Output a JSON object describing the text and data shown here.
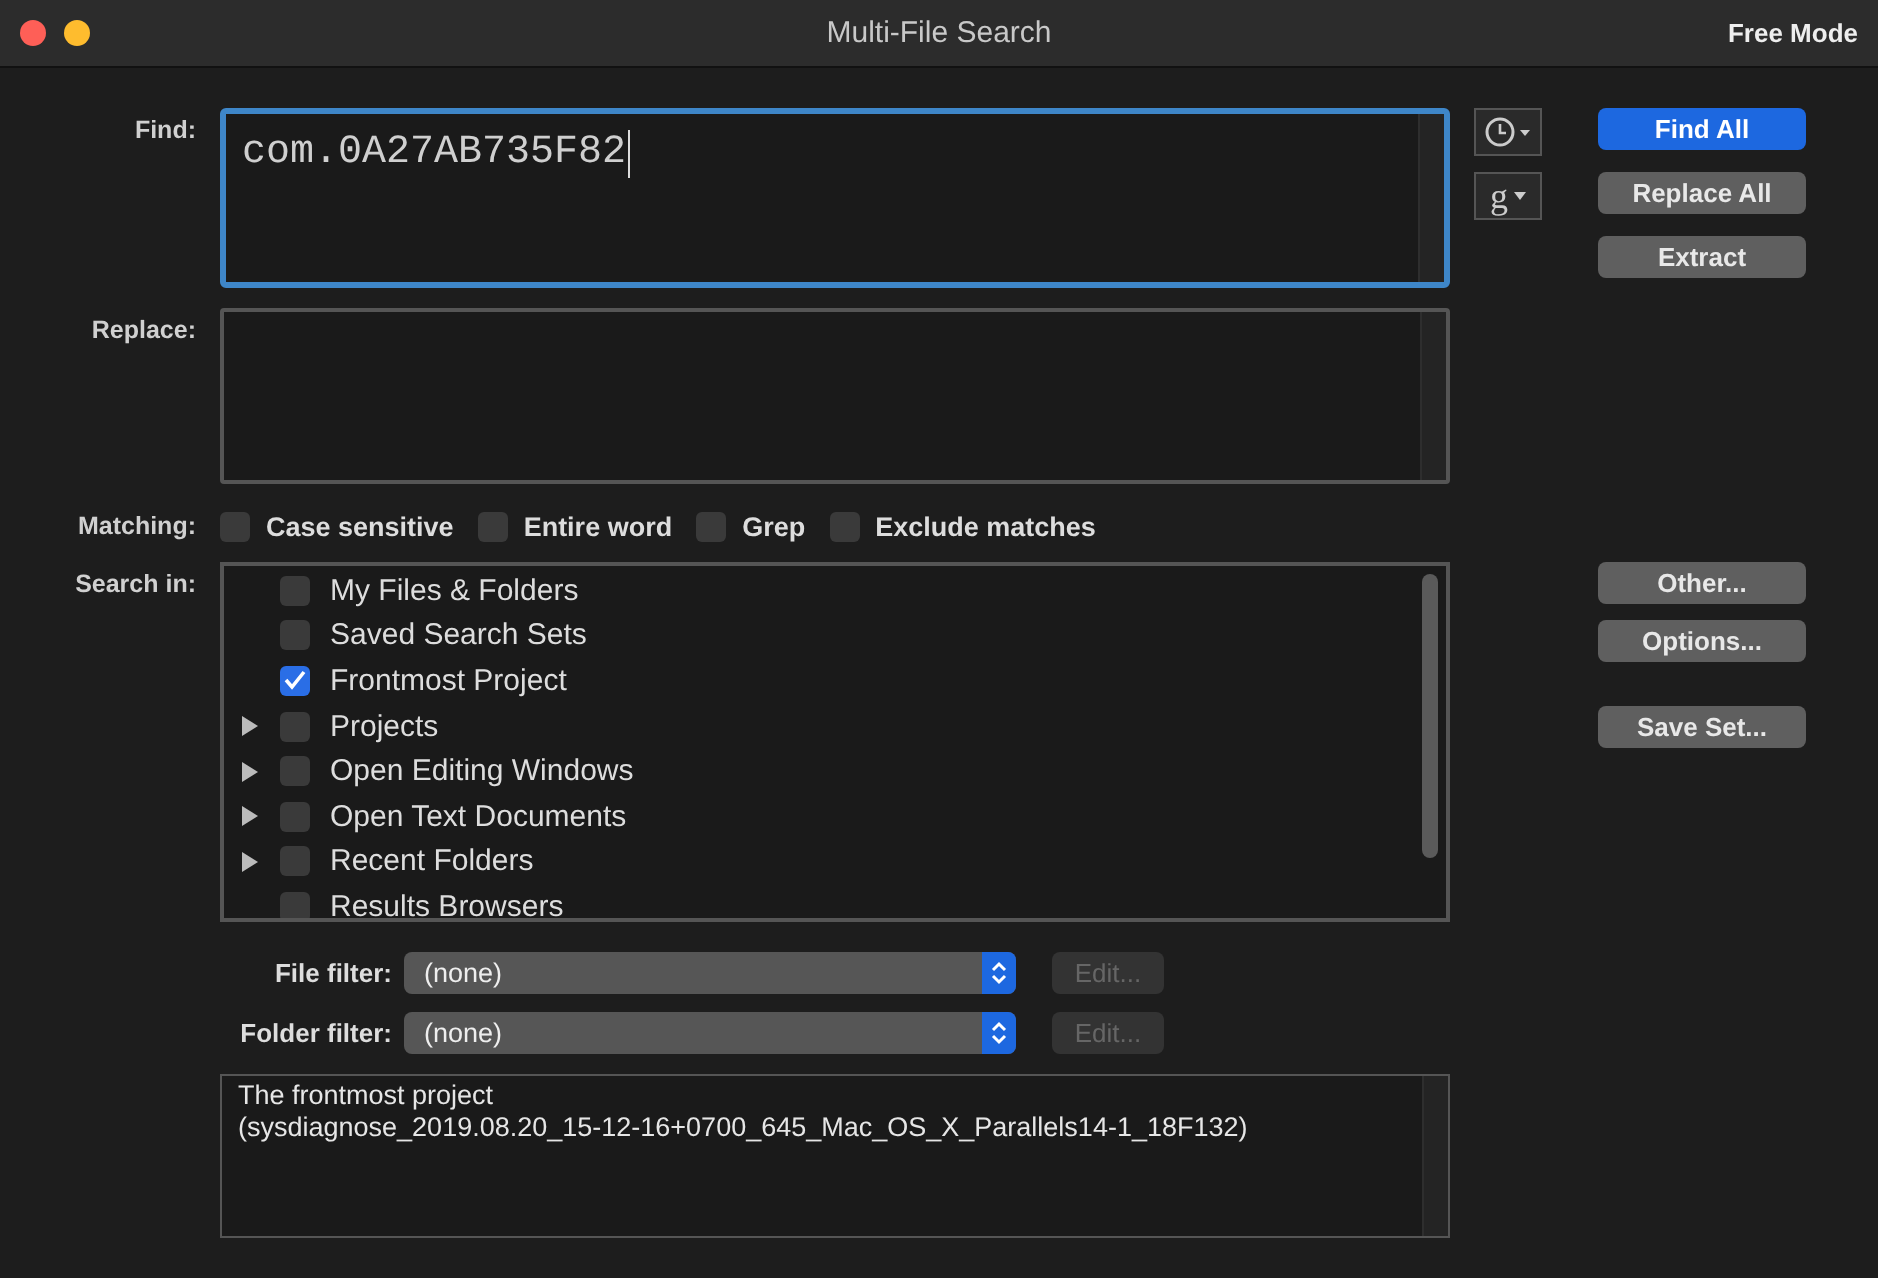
{
  "window": {
    "title": "Multi-File Search",
    "mode_label": "Free Mode"
  },
  "find": {
    "label": "Find:",
    "value": "com.0A27AB735F82",
    "grep_menu_label": "g"
  },
  "replace": {
    "label": "Replace:"
  },
  "primary_buttons": [
    {
      "label": "Find All",
      "default": true
    },
    {
      "label": "Replace All",
      "default": false
    },
    {
      "label": "Extract",
      "default": false
    }
  ],
  "matching": {
    "label": "Matching:",
    "options": [
      {
        "label": "Case sensitive",
        "checked": false
      },
      {
        "label": "Entire word",
        "checked": false
      },
      {
        "label": "Grep",
        "checked": false
      },
      {
        "label": "Exclude matches",
        "checked": false
      }
    ]
  },
  "search_in": {
    "label": "Search in:",
    "items": [
      {
        "label": "My Files & Folders",
        "checked": false,
        "has_children": false
      },
      {
        "label": "Saved Search Sets",
        "checked": false,
        "has_children": false
      },
      {
        "label": "Frontmost Project",
        "checked": true,
        "has_children": false
      },
      {
        "label": "Projects",
        "checked": false,
        "has_children": true
      },
      {
        "label": "Open Editing Windows",
        "checked": false,
        "has_children": true
      },
      {
        "label": "Open Text Documents",
        "checked": false,
        "has_children": true
      },
      {
        "label": "Recent Folders",
        "checked": false,
        "has_children": true
      },
      {
        "label": "Results Browsers",
        "checked": false,
        "has_children": false
      }
    ]
  },
  "set_buttons": [
    {
      "label": "Other..."
    },
    {
      "label": "Options..."
    },
    {
      "label": "Save Set..."
    }
  ],
  "filters": [
    {
      "label": "File filter:",
      "value": "(none)",
      "edit_label": "Edit...",
      "edit_disabled": true
    },
    {
      "label": "Folder filter:",
      "value": "(none)",
      "edit_label": "Edit...",
      "edit_disabled": true
    }
  ],
  "description": [
    "The frontmost project",
    "(sysdiagnose_2019.08.20_15-12-16+0700_645_Mac_OS_X_Parallels14-1_18F132)"
  ]
}
